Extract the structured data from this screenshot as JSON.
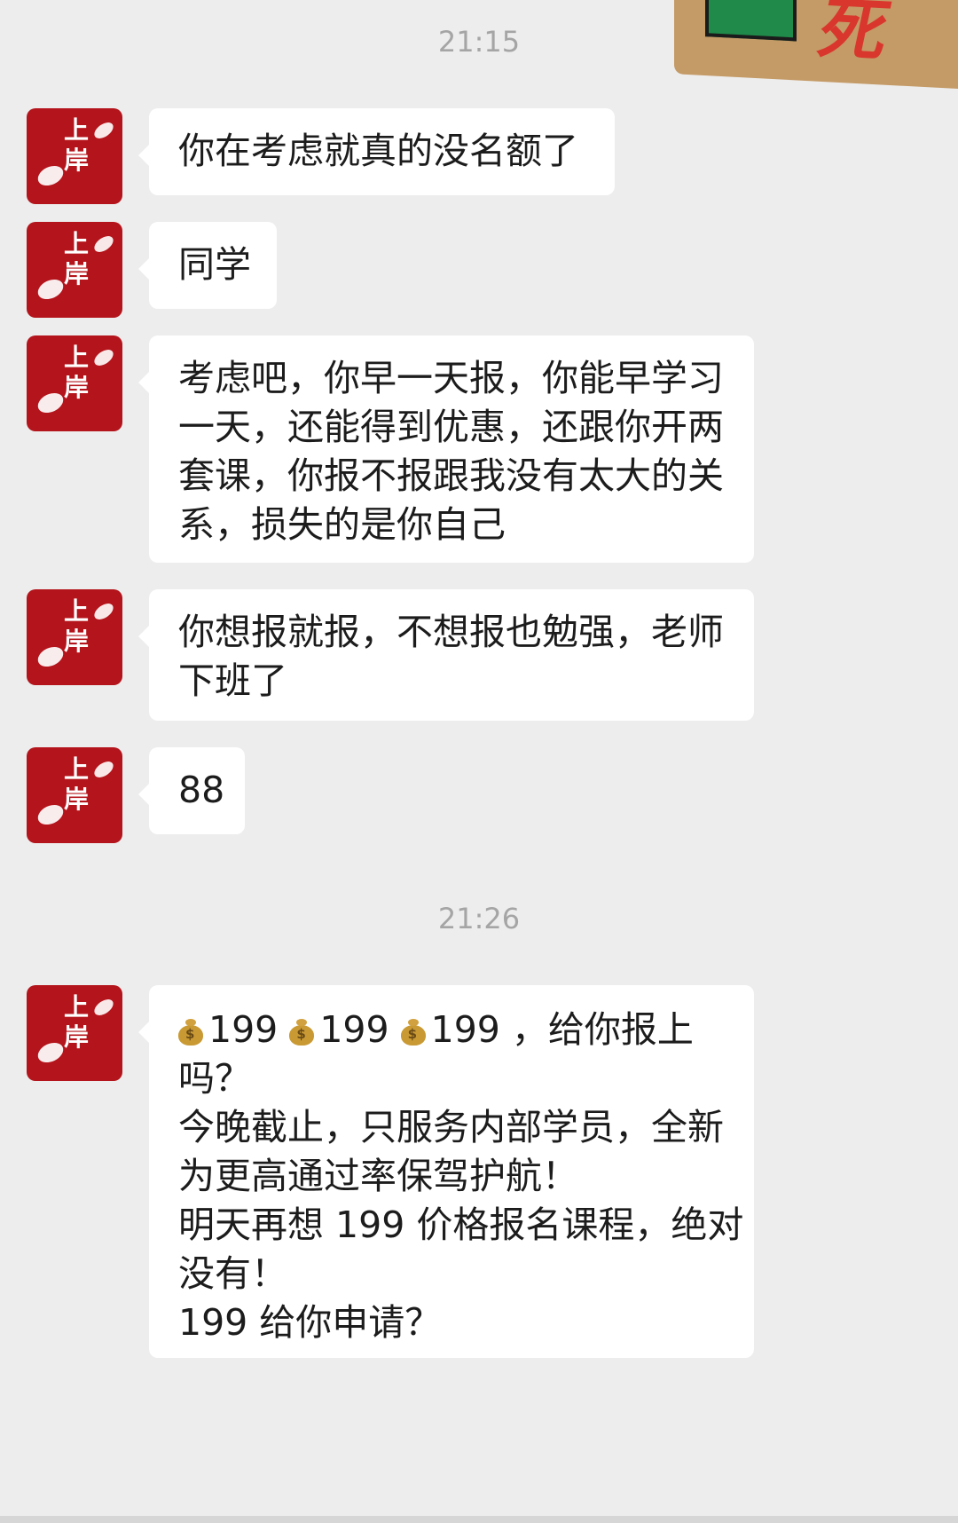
{
  "timestamps": {
    "first": "21:15",
    "second": "21:26"
  },
  "contact": {
    "avatar_text": "上岸"
  },
  "sticker": {
    "visible_text": "死"
  },
  "messages": [
    {
      "lines": [
        "你在考虑就真的没名额了"
      ]
    },
    {
      "lines": [
        "同学"
      ]
    },
    {
      "lines": [
        "考虑吧，你早一天报，你能早学习",
        "一天，还能得到优惠，还跟你开两",
        "套课，你报不报跟我没有太大的关",
        "系，损失的是你自己"
      ]
    },
    {
      "lines": [
        "你想报就报，不想报也勉强，老师",
        "下班了"
      ]
    },
    {
      "lines": [
        "88"
      ]
    },
    {
      "lines": [
        "199",
        "199",
        "199 ，给你报上",
        "吗？",
        "今晚截止，只服务内部学员，全新",
        "为更高通过率保驾护航！",
        "明天再想 199 价格报名课程，绝对",
        "没有！",
        "199 给你申请？"
      ]
    }
  ],
  "icons": {
    "money_bag": "money-bag-icon",
    "avatar": "koi-logo"
  },
  "colors": {
    "background": "#ededed",
    "bubble": "#ffffff",
    "avatar": "#b4141b",
    "timestamp": "#a5a5a5"
  }
}
